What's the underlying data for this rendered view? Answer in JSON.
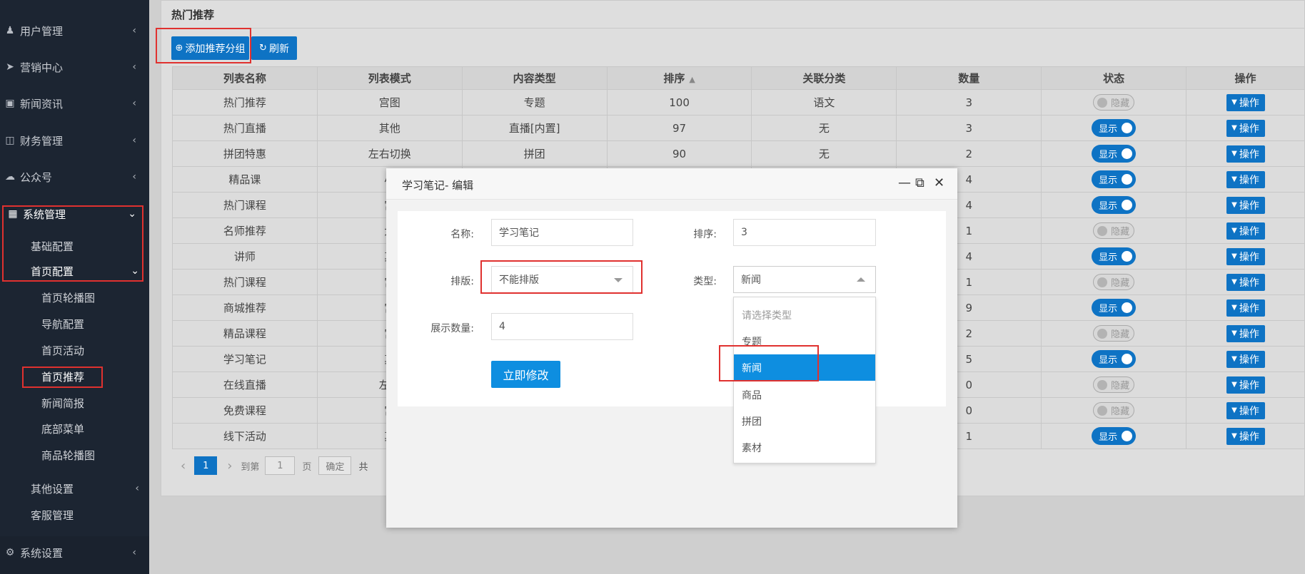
{
  "sidebar": {
    "menus": [
      {
        "label": "用户管理",
        "icon": "user-icon"
      },
      {
        "label": "营销中心",
        "icon": "paper-plane-icon"
      },
      {
        "label": "新闻资讯",
        "icon": "picture-icon"
      },
      {
        "label": "财务管理",
        "icon": "money-icon"
      },
      {
        "label": "公众号",
        "icon": "wechat-icon"
      }
    ],
    "system": {
      "label": "系统管理",
      "icon": "grid-icon"
    },
    "system_children": [
      "基础配置",
      "首页配置"
    ],
    "home_children": [
      "首页轮播图",
      "导航配置",
      "首页活动",
      "首页推荐",
      "新闻简报",
      "底部菜单",
      "商品轮播图"
    ],
    "other_children": [
      "其他设置",
      "客服管理"
    ],
    "settings": {
      "label": "系统设置",
      "icon": "gear-icon"
    }
  },
  "main": {
    "title": "热门推荐",
    "add_button": "添加推荐分组",
    "refresh_button": "刷新"
  },
  "table": {
    "headers": [
      "列表名称",
      "列表模式",
      "内容类型",
      "排序",
      "关联分类",
      "数量",
      "状态",
      "操作"
    ],
    "rows": [
      {
        "name": "热门推荐",
        "mode": "宫图",
        "type": "专题",
        "sort": "100",
        "cat": "语文",
        "count": "3",
        "status": "off"
      },
      {
        "name": "热门直播",
        "mode": "其他",
        "type": "直播[内置]",
        "sort": "97",
        "cat": "无",
        "count": "3",
        "status": "on"
      },
      {
        "name": "拼团特惠",
        "mode": "左右切换",
        "type": "拼团",
        "sort": "90",
        "cat": "无",
        "count": "2",
        "status": "on"
      },
      {
        "name": "精品课",
        "mode": "小",
        "type": "",
        "sort": "",
        "cat": "",
        "count": "4",
        "status": "on"
      },
      {
        "name": "热门课程",
        "mode": "宫",
        "type": "",
        "sort": "",
        "cat": "",
        "count": "4",
        "status": "on"
      },
      {
        "name": "名师推荐",
        "mode": "大",
        "type": "",
        "sort": "",
        "cat": "",
        "count": "1",
        "status": "off"
      },
      {
        "name": "讲师",
        "mode": "其",
        "type": "",
        "sort": "",
        "cat": "",
        "count": "4",
        "status": "on"
      },
      {
        "name": "热门课程",
        "mode": "宫",
        "type": "",
        "sort": "",
        "cat": "",
        "count": "1",
        "status": "off"
      },
      {
        "name": "商城推荐",
        "mode": "宫",
        "type": "",
        "sort": "",
        "cat": "",
        "count": "9",
        "status": "on"
      },
      {
        "name": "精品课程",
        "mode": "宫",
        "type": "",
        "sort": "",
        "cat": "",
        "count": "2",
        "status": "off"
      },
      {
        "name": "学习笔记",
        "mode": "其",
        "type": "",
        "sort": "",
        "cat": "",
        "count": "5",
        "status": "on"
      },
      {
        "name": "在线直播",
        "mode": "左右",
        "type": "",
        "sort": "",
        "cat": "",
        "count": "0",
        "status": "off"
      },
      {
        "name": "免费课程",
        "mode": "宫",
        "type": "",
        "sort": "",
        "cat": "",
        "count": "0",
        "status": "off"
      },
      {
        "name": "线下活动",
        "mode": "其",
        "type": "",
        "sort": "",
        "cat": "",
        "count": "1",
        "status": "on"
      }
    ],
    "status_on_label": "显示",
    "status_off_label": "隐藏",
    "op_label": "操作"
  },
  "pager": {
    "current": "1",
    "goto_label": "到第",
    "goto_value": "1",
    "page_unit": "页",
    "confirm": "确定",
    "total_prefix": "共"
  },
  "modal": {
    "title": "学习笔记- 编辑",
    "name_label": "名称:",
    "name_value": "学习笔记",
    "sort_label": "排序:",
    "sort_value": "3",
    "layout_label": "排版:",
    "layout_value": "不能排版",
    "type_label": "类型:",
    "type_value": "新闻",
    "count_label": "展示数量:",
    "count_value": "4",
    "submit": "立即修改",
    "type_options": [
      "请选择类型",
      "专题",
      "新闻",
      "商品",
      "拼团",
      "素材"
    ],
    "selected_option_index": 2
  },
  "colors": {
    "primary": "#0e73c4",
    "highlight": "#0e8ee0",
    "sidebar": "#1c2532",
    "annotation": "#e0312f"
  }
}
